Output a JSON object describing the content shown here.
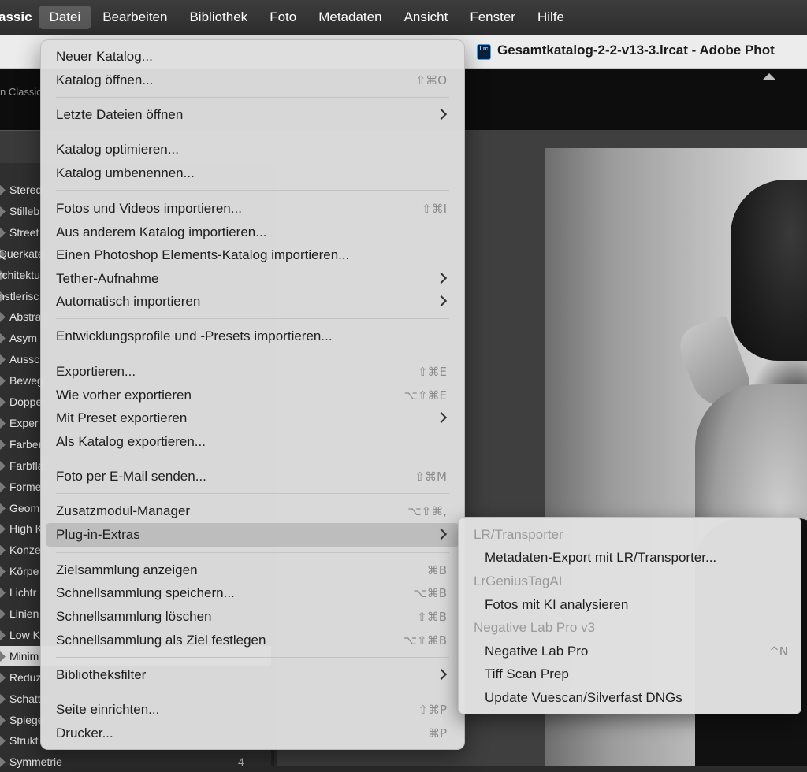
{
  "menubar": {
    "app_name": "assic",
    "items": [
      "Datei",
      "Bearbeiten",
      "Bibliothek",
      "Foto",
      "Metadaten",
      "Ansicht",
      "Fenster",
      "Hilfe"
    ],
    "active_item": "Datei"
  },
  "titlebar": {
    "icon_text": "Lrc",
    "title": "Gesamtkatalog-2-2-v13-3.lrcat - Adobe Phot"
  },
  "lightroom": {
    "brand_fragment": "n Classic",
    "collections": [
      {
        "label": "Stered",
        "count": ""
      },
      {
        "label": "Stilleb",
        "count": ""
      },
      {
        "label": "Street",
        "count": ""
      },
      {
        "label": "Querkate",
        "count": ""
      },
      {
        "label": "rchitektu",
        "count": ""
      },
      {
        "label": "nstlerisc",
        "count": ""
      },
      {
        "label": "Abstra",
        "count": ""
      },
      {
        "label": "Asym",
        "count": ""
      },
      {
        "label": "Aussc",
        "count": ""
      },
      {
        "label": "Beweg",
        "count": ""
      },
      {
        "label": "Doppe",
        "count": ""
      },
      {
        "label": "Exper",
        "count": ""
      },
      {
        "label": "Farber",
        "count": ""
      },
      {
        "label": "Farbfla",
        "count": ""
      },
      {
        "label": "Forme",
        "count": ""
      },
      {
        "label": "Geom",
        "count": ""
      },
      {
        "label": "High K",
        "count": ""
      },
      {
        "label": "Konze",
        "count": ""
      },
      {
        "label": "Körpe",
        "count": ""
      },
      {
        "label": "Lichtr",
        "count": ""
      },
      {
        "label": "Linien",
        "count": ""
      },
      {
        "label": "Low K",
        "count": ""
      },
      {
        "label": "Minim",
        "count": ""
      },
      {
        "label": "Reduz",
        "count": ""
      },
      {
        "label": "Schatt",
        "count": ""
      },
      {
        "label": "Spiege",
        "count": ""
      },
      {
        "label": "Strukt",
        "count": ""
      },
      {
        "label": "Symmetrie",
        "count": "4"
      }
    ],
    "selected_collection": "Minim"
  },
  "file_menu": {
    "items": [
      {
        "label": "Neuer Katalog...",
        "shortcut": ""
      },
      {
        "label": "Katalog öffnen...",
        "shortcut": "⇧⌘O"
      },
      {
        "label": "Letzte Dateien öffnen",
        "submenu": true
      },
      {
        "label": "Katalog optimieren...",
        "shortcut": ""
      },
      {
        "label": "Katalog umbenennen...",
        "shortcut": ""
      },
      {
        "label": "Fotos und Videos importieren...",
        "shortcut": "⇧⌘I"
      },
      {
        "label": "Aus anderem Katalog importieren...",
        "shortcut": ""
      },
      {
        "label": "Einen Photoshop Elements-Katalog importieren...",
        "shortcut": ""
      },
      {
        "label": "Tether-Aufnahme",
        "submenu": true
      },
      {
        "label": "Automatisch importieren",
        "submenu": true
      },
      {
        "label": "Entwicklungsprofile und -Presets importieren...",
        "shortcut": ""
      },
      {
        "label": "Exportieren...",
        "shortcut": "⇧⌘E"
      },
      {
        "label": "Wie vorher exportieren",
        "shortcut": "⌥⇧⌘E"
      },
      {
        "label": "Mit Preset exportieren",
        "submenu": true
      },
      {
        "label": "Als Katalog exportieren...",
        "shortcut": ""
      },
      {
        "label": "Foto per E-Mail senden...",
        "shortcut": "⇧⌘M"
      },
      {
        "label": "Zusatzmodul-Manager",
        "shortcut": "⌥⇧⌘,"
      },
      {
        "label": "Plug-in-Extras",
        "submenu": true,
        "highlighted": true
      },
      {
        "label": "Zielsammlung anzeigen",
        "shortcut": "⌘B"
      },
      {
        "label": "Schnellsammlung speichern...",
        "shortcut": "⌥⌘B"
      },
      {
        "label": "Schnellsammlung löschen",
        "shortcut": "⇧⌘B"
      },
      {
        "label": "Schnellsammlung als Ziel festlegen",
        "shortcut": "⌥⇧⌘B"
      },
      {
        "label": "Bibliotheksfilter",
        "submenu": true
      },
      {
        "label": "Seite einrichten...",
        "shortcut": "⇧⌘P"
      },
      {
        "label": "Drucker...",
        "shortcut": "⌘P"
      }
    ]
  },
  "plugin_submenu": {
    "items": [
      {
        "label": "LR/Transporter",
        "header": true
      },
      {
        "label": "Metadaten-Export mit LR/Transporter...",
        "shortcut": ""
      },
      {
        "label": "LrGeniusTagAI",
        "header": true
      },
      {
        "label": "Fotos mit KI analysieren",
        "shortcut": ""
      },
      {
        "label": "Negative Lab Pro v3",
        "header": true
      },
      {
        "label": "Negative Lab Pro",
        "shortcut": "^N"
      },
      {
        "label": "Tiff Scan Prep",
        "shortcut": ""
      },
      {
        "label": "Update Vuescan/Silverfast DNGs",
        "shortcut": ""
      }
    ]
  }
}
